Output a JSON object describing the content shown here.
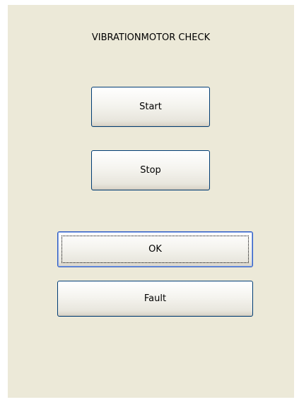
{
  "dialog": {
    "title": "VIBRATIONMOTOR CHECK",
    "buttons": {
      "start": "Start",
      "stop": "Stop",
      "ok": "OK",
      "fault": "Fault"
    },
    "focused_button": "ok"
  }
}
